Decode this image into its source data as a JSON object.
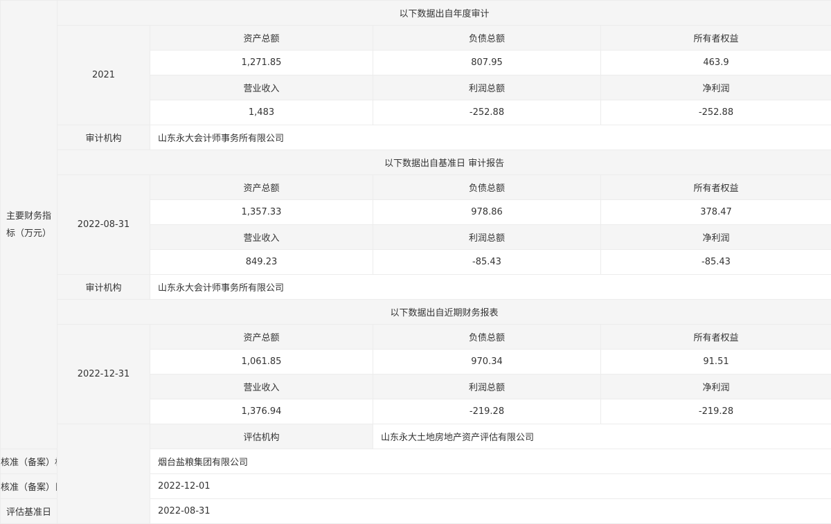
{
  "side_label": "主要财务指标（万元）",
  "labels": {
    "assets": "资产总额",
    "liabilities": "负债总额",
    "equity": "所有者权益",
    "revenue": "营业收入",
    "total_profit": "利润总额",
    "net_profit": "净利润",
    "audit_org": "审计机构"
  },
  "sections": [
    {
      "header": "以下数据出自年度审计",
      "period": "2021",
      "assets": "1,271.85",
      "liabilities": "807.95",
      "equity": "463.9",
      "revenue": "1,483",
      "total_profit": "-252.88",
      "net_profit": "-252.88",
      "audit_org": "山东永大会计师事务所有限公司"
    },
    {
      "header": "以下数据出自基准日 审计报告",
      "period": "2022-08-31",
      "assets": "1,357.33",
      "liabilities": "978.86",
      "equity": "378.47",
      "revenue": "849.23",
      "total_profit": "-85.43",
      "net_profit": "-85.43",
      "audit_org": "山东永大会计师事务所有限公司"
    },
    {
      "header": "以下数据出自近期财务报表",
      "period": "2022-12-31",
      "assets": "1,061.85",
      "liabilities": "970.34",
      "equity": "91.51",
      "revenue": "1,376.94",
      "total_profit": "-219.28",
      "net_profit": "-219.28"
    }
  ],
  "footer": [
    {
      "label": "评估机构",
      "value": "山东永大土地房地产资产评估有限公司"
    },
    {
      "label": "核准（备案）机构",
      "value": "烟台盐粮集团有限公司"
    },
    {
      "label": "核准（备案）日期",
      "value": "2022-12-01"
    },
    {
      "label": "评估基准日",
      "value": "2022-08-31"
    }
  ]
}
